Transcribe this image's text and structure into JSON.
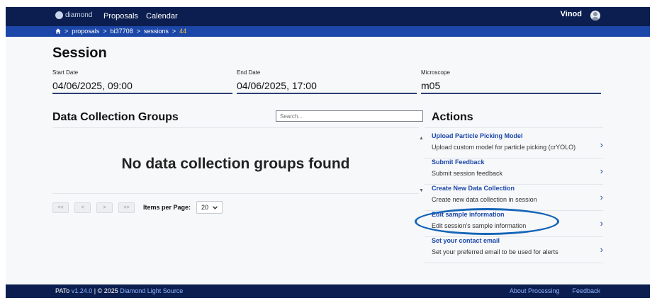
{
  "header": {
    "logo_text": "diamond",
    "nav": [
      "Proposals",
      "Calendar"
    ],
    "user_name": "Vinod"
  },
  "breadcrumb": {
    "items": [
      "proposals",
      "bi37708",
      "sessions"
    ],
    "current": "44",
    "separator": ">"
  },
  "session": {
    "title": "Session",
    "start_label": "Start Date",
    "start_value": "04/06/2025, 09:00",
    "end_label": "End Date",
    "end_value": "04/06/2025, 17:00",
    "microscope_label": "Microscope",
    "microscope_value": "m05"
  },
  "dcg": {
    "title": "Data Collection Groups",
    "search_placeholder": "Search...",
    "empty_message": "No data collection groups found",
    "pager": {
      "first": "<<",
      "prev": "<",
      "next": ">",
      "last": ">>",
      "per_page_label": "Items per Page:",
      "per_page_value": "20"
    }
  },
  "actions": {
    "title": "Actions",
    "items": [
      {
        "title": "Upload Particle Picking Model",
        "desc": "Upload custom model for particle picking (crYOLO)",
        "caret": "▲"
      },
      {
        "title": "Submit Feedback",
        "desc": "Submit session feedback",
        "caret": ""
      },
      {
        "title": "Create New Data Collection",
        "desc": "Create new data collection in session",
        "caret": "▼"
      },
      {
        "title": "Edit sample information",
        "desc": "Edit session's sample information",
        "caret": ""
      },
      {
        "title": "Set your contact email",
        "desc": "Set your preferred email to be used for alerts",
        "caret": ""
      }
    ]
  },
  "footer": {
    "product": "PATo",
    "version": "v1.24.0",
    "copyright": "| © 2025",
    "org_link": "Diamond Light Source",
    "links": [
      "About Processing",
      "Feedback"
    ]
  },
  "colors": {
    "navbar": "#0b1e4f",
    "breadcrumb_bar": "#1c47a8",
    "accent_link": "#1c47a8",
    "annotation": "#1565b8"
  }
}
